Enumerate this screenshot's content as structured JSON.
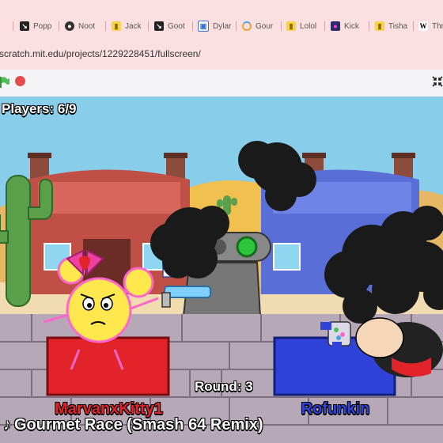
{
  "browser": {
    "tabs": [
      {
        "label": "l",
        "icon": "tab-icon"
      },
      {
        "label": "Popp",
        "icon": "scratch-icon"
      },
      {
        "label": "Noot",
        "icon": "character-icon"
      },
      {
        "label": "Jack",
        "icon": "bookmark-icon"
      },
      {
        "label": "Goot",
        "icon": "scratch-icon"
      },
      {
        "label": "Dylar",
        "icon": "photo-icon"
      },
      {
        "label": "Gour",
        "icon": "loading-icon"
      },
      {
        "label": "Lolol",
        "icon": "bookmark-icon"
      },
      {
        "label": "Kick",
        "icon": "character-icon"
      },
      {
        "label": "Tisha",
        "icon": "bookmark-icon"
      },
      {
        "label": "Thr",
        "icon": "wikipedia-icon"
      }
    ],
    "url": "scratch.mit.edu/projects/1229228451/fullscreen/"
  },
  "game": {
    "players_label": "Players: 6/9",
    "round_label": "Round: 3",
    "player_left": "MarvanxKitty1",
    "player_right": "Rofunkin",
    "music_title": "Gourmet Race (Smash 64 Remix)",
    "music_icon": "music-note-icon"
  },
  "colors": {
    "tab_bar_bg": "#fcdfe0",
    "left_pad": "#e0242a",
    "right_pad": "#2f43d8",
    "sky": "#88cdea",
    "ground": "#f0dcb0",
    "stop_button": "#e54b4b",
    "green_flag": "#4cbf56"
  }
}
